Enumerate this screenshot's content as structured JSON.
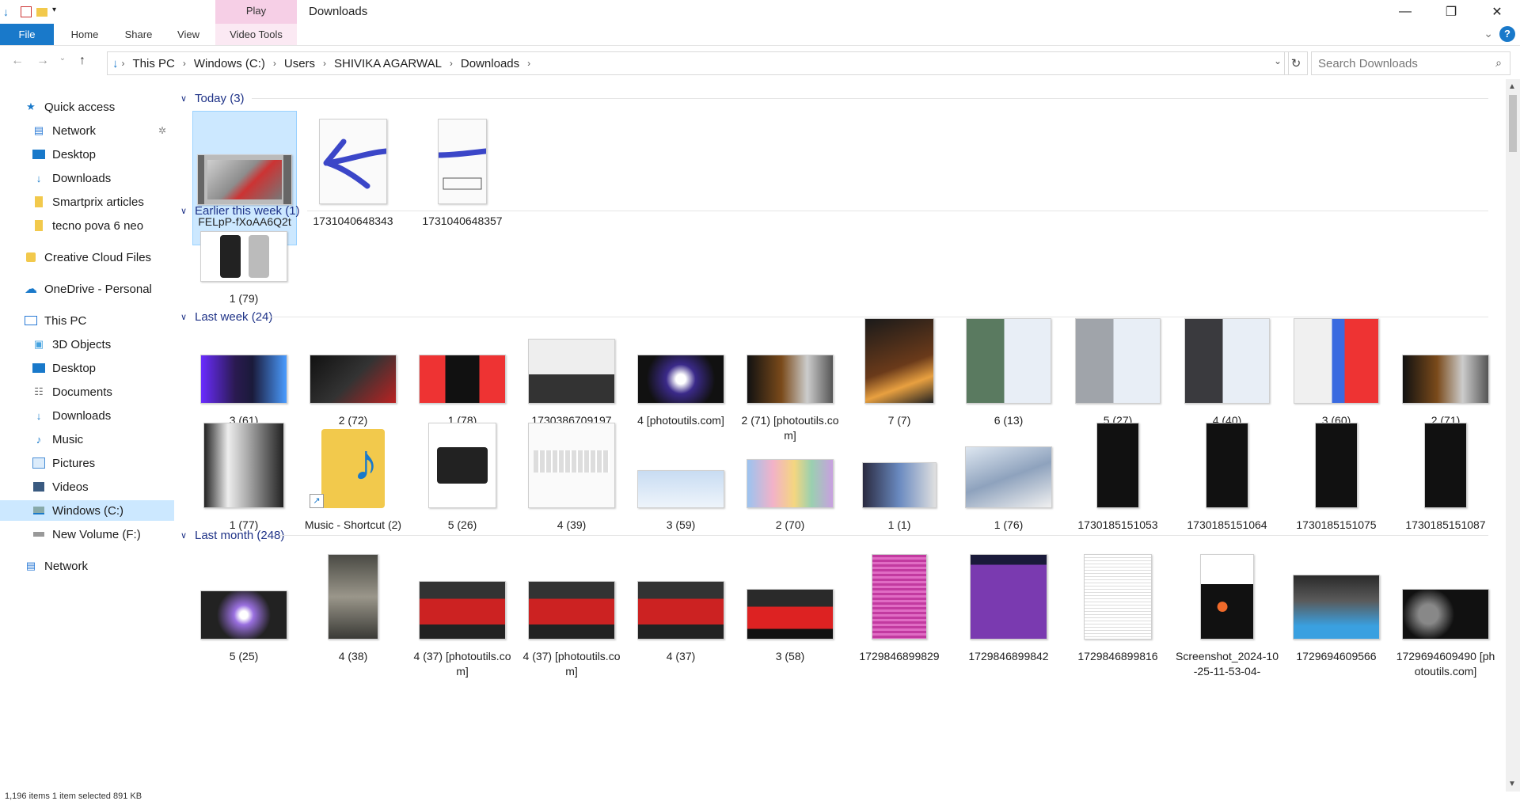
{
  "window": {
    "title": "Downloads",
    "context_group": "Play"
  },
  "ribbon": {
    "tabs": [
      "File",
      "Home",
      "Share",
      "View",
      "Video Tools"
    ]
  },
  "nav": {
    "breadcrumbs": [
      "This PC",
      "Windows (C:)",
      "Users",
      "SHIVIKA AGARWAL",
      "Downloads"
    ],
    "search_placeholder": "Search Downloads"
  },
  "sidebar": {
    "items": [
      {
        "label": "Quick access",
        "icon": "star-icon"
      },
      {
        "label": "Network",
        "icon": "network-icon"
      },
      {
        "label": "Desktop",
        "icon": "desktop-icon"
      },
      {
        "label": "Downloads",
        "icon": "download-icon"
      },
      {
        "label": "Smartprix articles",
        "icon": "folder-icon"
      },
      {
        "label": "tecno pova 6 neo",
        "icon": "folder-icon"
      },
      {
        "label": "Creative Cloud Files",
        "icon": "creative-cloud-icon"
      },
      {
        "label": "OneDrive - Personal",
        "icon": "onedrive-icon"
      },
      {
        "label": "This PC",
        "icon": "pc-icon"
      },
      {
        "label": "3D Objects",
        "icon": "cube-icon"
      },
      {
        "label": "Desktop",
        "icon": "desktop-icon"
      },
      {
        "label": "Documents",
        "icon": "document-icon"
      },
      {
        "label": "Downloads",
        "icon": "download-icon"
      },
      {
        "label": "Music",
        "icon": "music-icon"
      },
      {
        "label": "Pictures",
        "icon": "pictures-icon"
      },
      {
        "label": "Videos",
        "icon": "video-icon"
      },
      {
        "label": "Windows (C:)",
        "icon": "drive-icon"
      },
      {
        "label": "New Volume (F:)",
        "icon": "drive-icon"
      },
      {
        "label": "Network",
        "icon": "network-icon"
      }
    ]
  },
  "groups": [
    {
      "title": "Today (3)",
      "items": [
        {
          "name": "FELpP-fXoAA6Q2t",
          "kind": "video"
        },
        {
          "name": "1731040648343",
          "kind": "doc"
        },
        {
          "name": "1731040648357",
          "kind": "doc"
        }
      ]
    },
    {
      "title": "Earlier this week (1)",
      "items": [
        {
          "name": "1 (79)",
          "kind": "phone"
        }
      ]
    },
    {
      "title": "Last week (24)",
      "items": [
        {
          "name": "3 (61)"
        },
        {
          "name": "2 (72)"
        },
        {
          "name": "1 (78)"
        },
        {
          "name": "1730386709197"
        },
        {
          "name": "4 [photoutils.com]"
        },
        {
          "name": "2 (71) [photoutils.com]"
        },
        {
          "name": "7 (7)"
        },
        {
          "name": "6 (13)"
        },
        {
          "name": "5 (27)"
        },
        {
          "name": "4 (40)"
        },
        {
          "name": "3 (60)"
        },
        {
          "name": "2 (71)"
        },
        {
          "name": "1 (77)"
        },
        {
          "name": "Music - Shortcut (2)"
        },
        {
          "name": "5 (26)"
        },
        {
          "name": "4 (39)"
        },
        {
          "name": "3 (59)"
        },
        {
          "name": "2 (70)"
        },
        {
          "name": "1 (1)"
        },
        {
          "name": "1 (76)"
        },
        {
          "name": "1730185151053"
        },
        {
          "name": "1730185151064"
        },
        {
          "name": "1730185151075"
        },
        {
          "name": "1730185151087"
        }
      ]
    },
    {
      "title": "Last month (248)",
      "items": [
        {
          "name": "5 (25)"
        },
        {
          "name": "4 (38)"
        },
        {
          "name": "4 (37) [photoutils.com]"
        },
        {
          "name": "4 (37) [photoutils.com]"
        },
        {
          "name": "4 (37)"
        },
        {
          "name": "3 (58)"
        },
        {
          "name": "1729846899829"
        },
        {
          "name": "1729846899842"
        },
        {
          "name": "1729846899816"
        },
        {
          "name": "Screenshot_2024-10-25-11-53-04-"
        },
        {
          "name": "1729694609566"
        },
        {
          "name": "1729694609490 [photoutils.com]"
        }
      ]
    }
  ],
  "status": {
    "text": "1,196 items    1 item selected  891 KB"
  },
  "colors": {
    "accent": "#1979ca",
    "selection": "#cce8ff",
    "group_header": "#1e3287",
    "context_tab": "#f6cfe6"
  }
}
